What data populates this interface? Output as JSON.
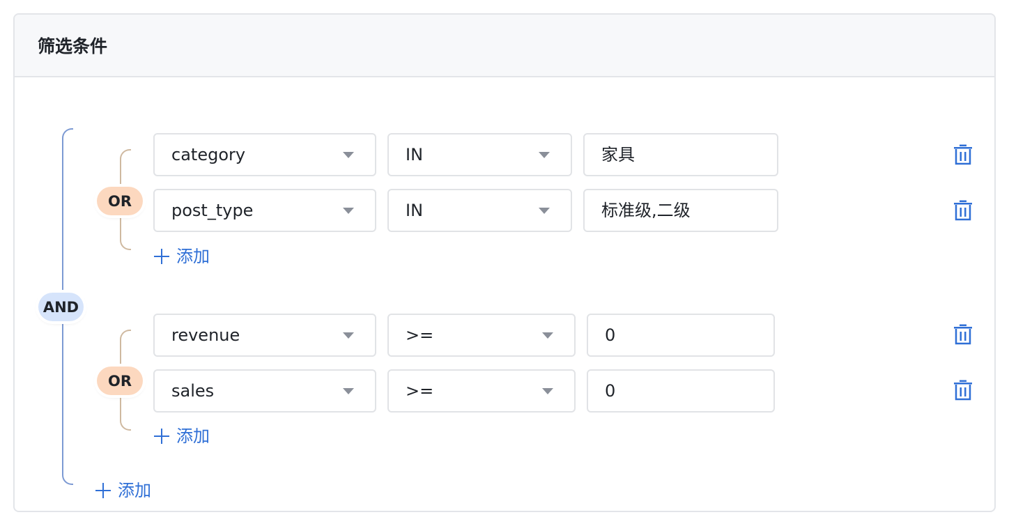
{
  "panel": {
    "title": "筛选条件"
  },
  "root": {
    "operator": "AND",
    "add_label": "添加",
    "groups": [
      {
        "operator": "OR",
        "add_label": "添加",
        "rows": [
          {
            "field": "category",
            "op": "IN",
            "value": "家具"
          },
          {
            "field": "post_type",
            "op": "IN",
            "value": "标准级,二级"
          }
        ]
      },
      {
        "operator": "OR",
        "add_label": "添加",
        "rows": [
          {
            "field": "revenue",
            "op": ">=",
            "value": "0"
          },
          {
            "field": "sales",
            "op": ">=",
            "value": "0"
          }
        ]
      }
    ]
  },
  "icons": {
    "delete": "trash-icon",
    "add": "plus-icon",
    "dropdown": "caret-down-icon"
  },
  "colors": {
    "accent": "#2f6fd6",
    "and_pill": "#d6e4fb",
    "or_pill": "#fcd8bf",
    "and_line": "#7c9ad3",
    "or_line": "#cfb9a0"
  }
}
